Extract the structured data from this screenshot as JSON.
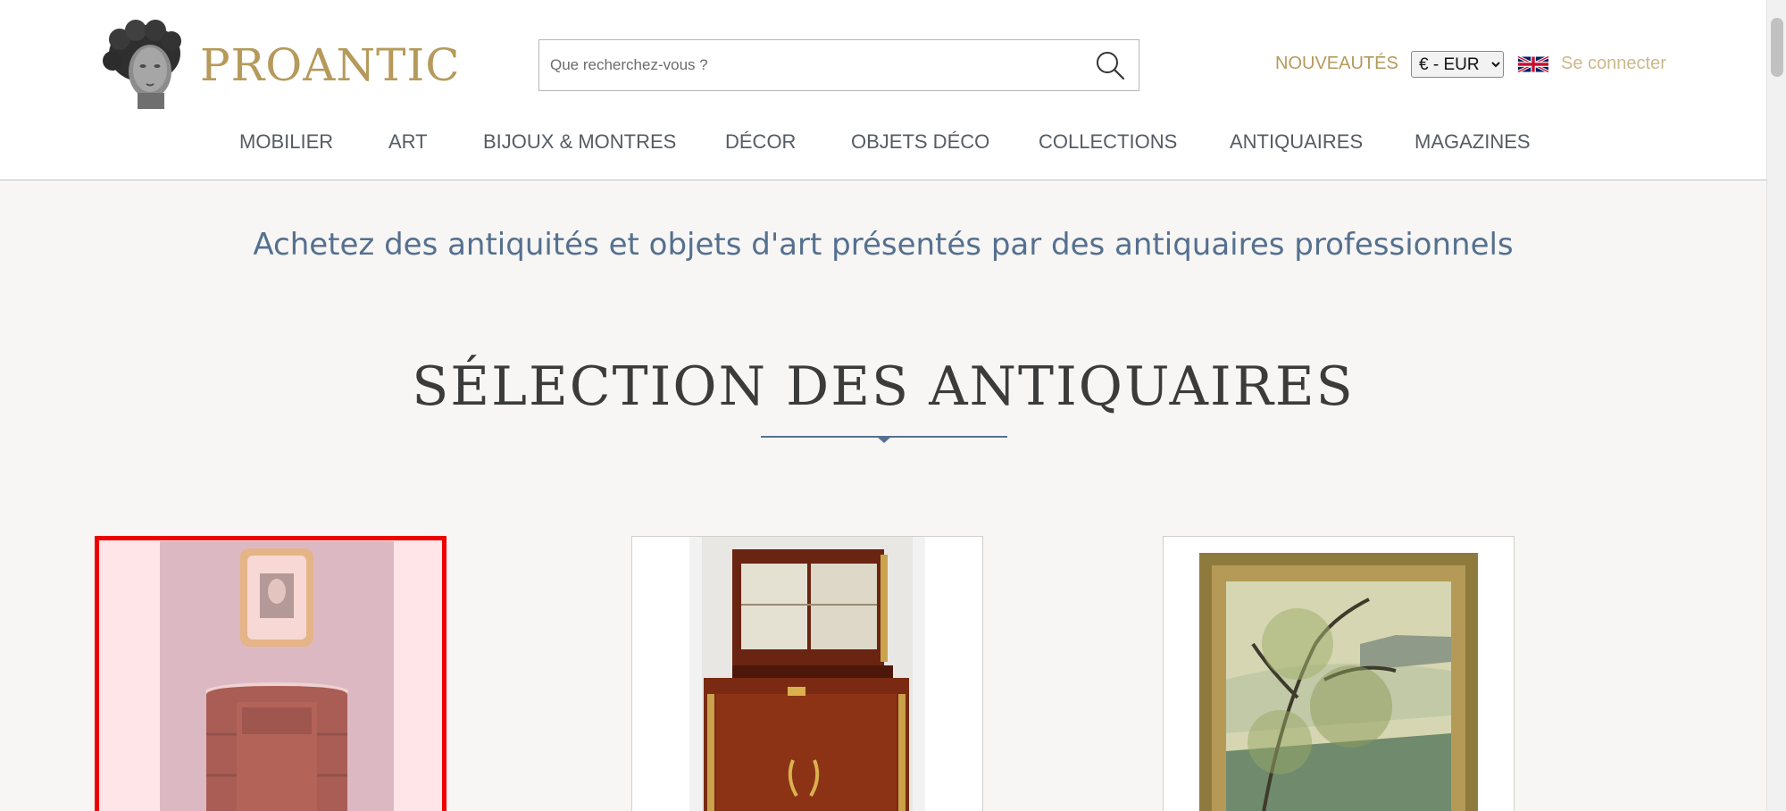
{
  "header": {
    "brand": "PROANTIC",
    "search": {
      "placeholder": "Que recherchez-vous ?",
      "value": ""
    },
    "nouveautes": "NOUVEAUTÉS",
    "currency": {
      "selected": "€ - EUR"
    },
    "login": "Se connecter"
  },
  "nav": {
    "items": [
      "MOBILIER",
      "ART",
      "BIJOUX & MONTRES",
      "DÉCOR",
      "OBJETS DÉCO",
      "COLLECTIONS",
      "ANTIQUAIRES",
      "MAGAZINES"
    ]
  },
  "main": {
    "tagline": "Achetez des antiquités et objets d'art présentés par des antiquaires professionnels",
    "section_title": "SÉLECTION DES ANTIQUAIRES"
  },
  "products": [
    {
      "image": "mahogany-half-moon-cabinet-with-framed-portrait",
      "selected": true
    },
    {
      "image": "mahogany-secretary-bookcase-with-lyre",
      "selected": false
    },
    {
      "image": "framed-painting-river-landscape-trees",
      "selected": false
    }
  ],
  "colors": {
    "accent_gold": "#b59a5b",
    "tagline_blue": "#55708f",
    "selection_red": "#ee0000"
  }
}
